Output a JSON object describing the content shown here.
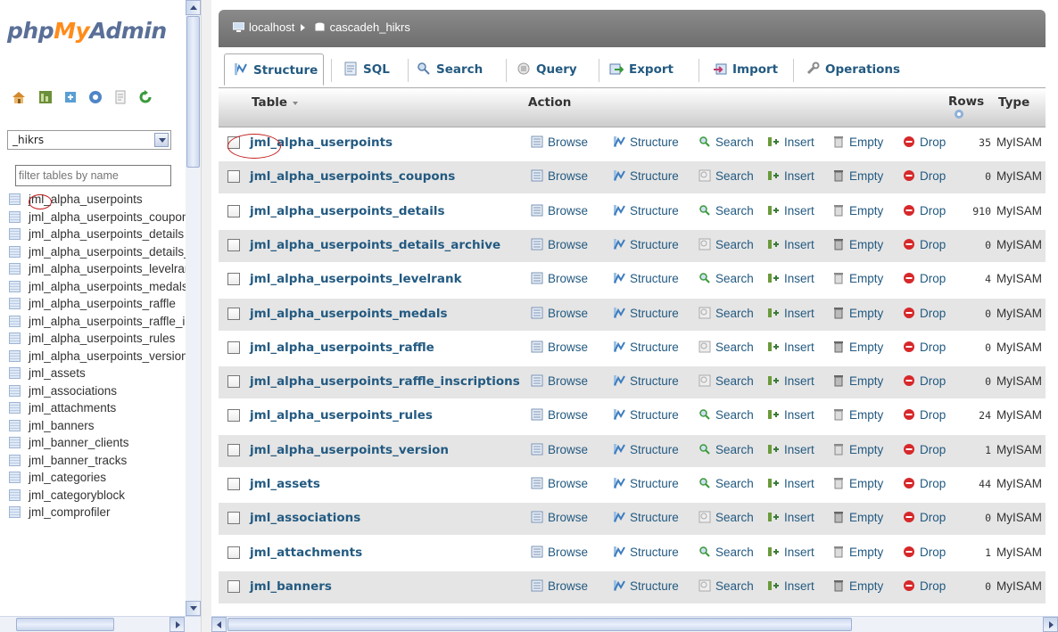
{
  "nav": {
    "logo": {
      "php": "php",
      "my": "My",
      "admin": "Admin"
    },
    "icons": [
      "home-icon",
      "query-window-icon",
      "sql-query-icon",
      "help-icon",
      "documentation-icon",
      "reload-icon"
    ],
    "db_select": {
      "value": "_hikrs"
    },
    "filter": {
      "placeholder": "filter tables by name"
    },
    "tables": [
      "jml_alpha_userpoints",
      "jml_alpha_userpoints_coupons",
      "jml_alpha_userpoints_details",
      "jml_alpha_userpoints_details_archive",
      "jml_alpha_userpoints_levelrank",
      "jml_alpha_userpoints_medals",
      "jml_alpha_userpoints_raffle",
      "jml_alpha_userpoints_raffle_inscriptions",
      "jml_alpha_userpoints_rules",
      "jml_alpha_userpoints_version",
      "jml_assets",
      "jml_associations",
      "jml_attachments",
      "jml_banners",
      "jml_banner_clients",
      "jml_banner_tracks",
      "jml_categories",
      "jml_categoryblock",
      "jml_comprofiler"
    ]
  },
  "breadcrumb": {
    "server": "localhost",
    "database": "cascadeh_hikrs"
  },
  "tabs": [
    {
      "label": "Structure",
      "icon": "structure-icon",
      "active": true
    },
    {
      "label": "SQL",
      "icon": "sql-icon"
    },
    {
      "label": "Search",
      "icon": "search-icon"
    },
    {
      "label": "Query",
      "icon": "query-icon"
    },
    {
      "label": "Export",
      "icon": "export-icon"
    },
    {
      "label": "Import",
      "icon": "import-icon"
    },
    {
      "label": "Operations",
      "icon": "operations-icon"
    }
  ],
  "table_header": {
    "table": "Table",
    "action": "Action",
    "rows": "Rows",
    "type": "Type"
  },
  "actions": {
    "browse": "Browse",
    "structure": "Structure",
    "search": "Search",
    "insert": "Insert",
    "empty": "Empty",
    "drop": "Drop"
  },
  "rows": [
    {
      "name": "jml_alpha_userpoints",
      "rows": "35",
      "type": "MyISAM"
    },
    {
      "name": "jml_alpha_userpoints_coupons",
      "rows": "0",
      "type": "MyISAM"
    },
    {
      "name": "jml_alpha_userpoints_details",
      "rows": "910",
      "type": "MyISAM"
    },
    {
      "name": "jml_alpha_userpoints_details_archive",
      "rows": "0",
      "type": "MyISAM"
    },
    {
      "name": "jml_alpha_userpoints_levelrank",
      "rows": "4",
      "type": "MyISAM"
    },
    {
      "name": "jml_alpha_userpoints_medals",
      "rows": "0",
      "type": "MyISAM"
    },
    {
      "name": "jml_alpha_userpoints_raffle",
      "rows": "0",
      "type": "MyISAM"
    },
    {
      "name": "jml_alpha_userpoints_raffle_inscriptions",
      "rows": "0",
      "type": "MyISAM"
    },
    {
      "name": "jml_alpha_userpoints_rules",
      "rows": "24",
      "type": "MyISAM"
    },
    {
      "name": "jml_alpha_userpoints_version",
      "rows": "1",
      "type": "MyISAM"
    },
    {
      "name": "jml_assets",
      "rows": "44",
      "type": "MyISAM"
    },
    {
      "name": "jml_associations",
      "rows": "0",
      "type": "MyISAM"
    },
    {
      "name": "jml_attachments",
      "rows": "1",
      "type": "MyISAM"
    },
    {
      "name": "jml_banners",
      "rows": "0",
      "type": "MyISAM"
    }
  ],
  "colors": {
    "link": "#235a81",
    "logo_blue": "#5a6f97",
    "logo_orange": "#ff8c1a",
    "annotation": "#c21f1f",
    "even_row": "#e5e5e5"
  }
}
